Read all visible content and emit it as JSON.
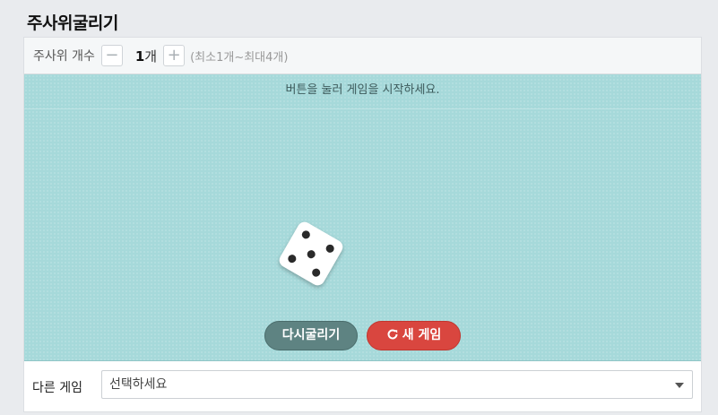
{
  "page": {
    "title": "주사위굴리기"
  },
  "toolbar": {
    "dice_count_label": "주사위 개수",
    "decrement": "−",
    "increment": "+",
    "count_value": "1",
    "count_unit": "개",
    "range_hint": "(최소1개~최대4개)"
  },
  "board": {
    "message": "버튼을 눌러 게임을 시작하세요.",
    "dice": [
      {
        "face": 5
      }
    ],
    "reroll_button": "다시굴리기",
    "new_game_button": "새 게임",
    "colors": {
      "board": "#a6d9da",
      "reroll": "#5e8382",
      "new_game": "#d9463f"
    }
  },
  "footer": {
    "other_game_label": "다른 게임",
    "select_value": "선택하세요"
  }
}
